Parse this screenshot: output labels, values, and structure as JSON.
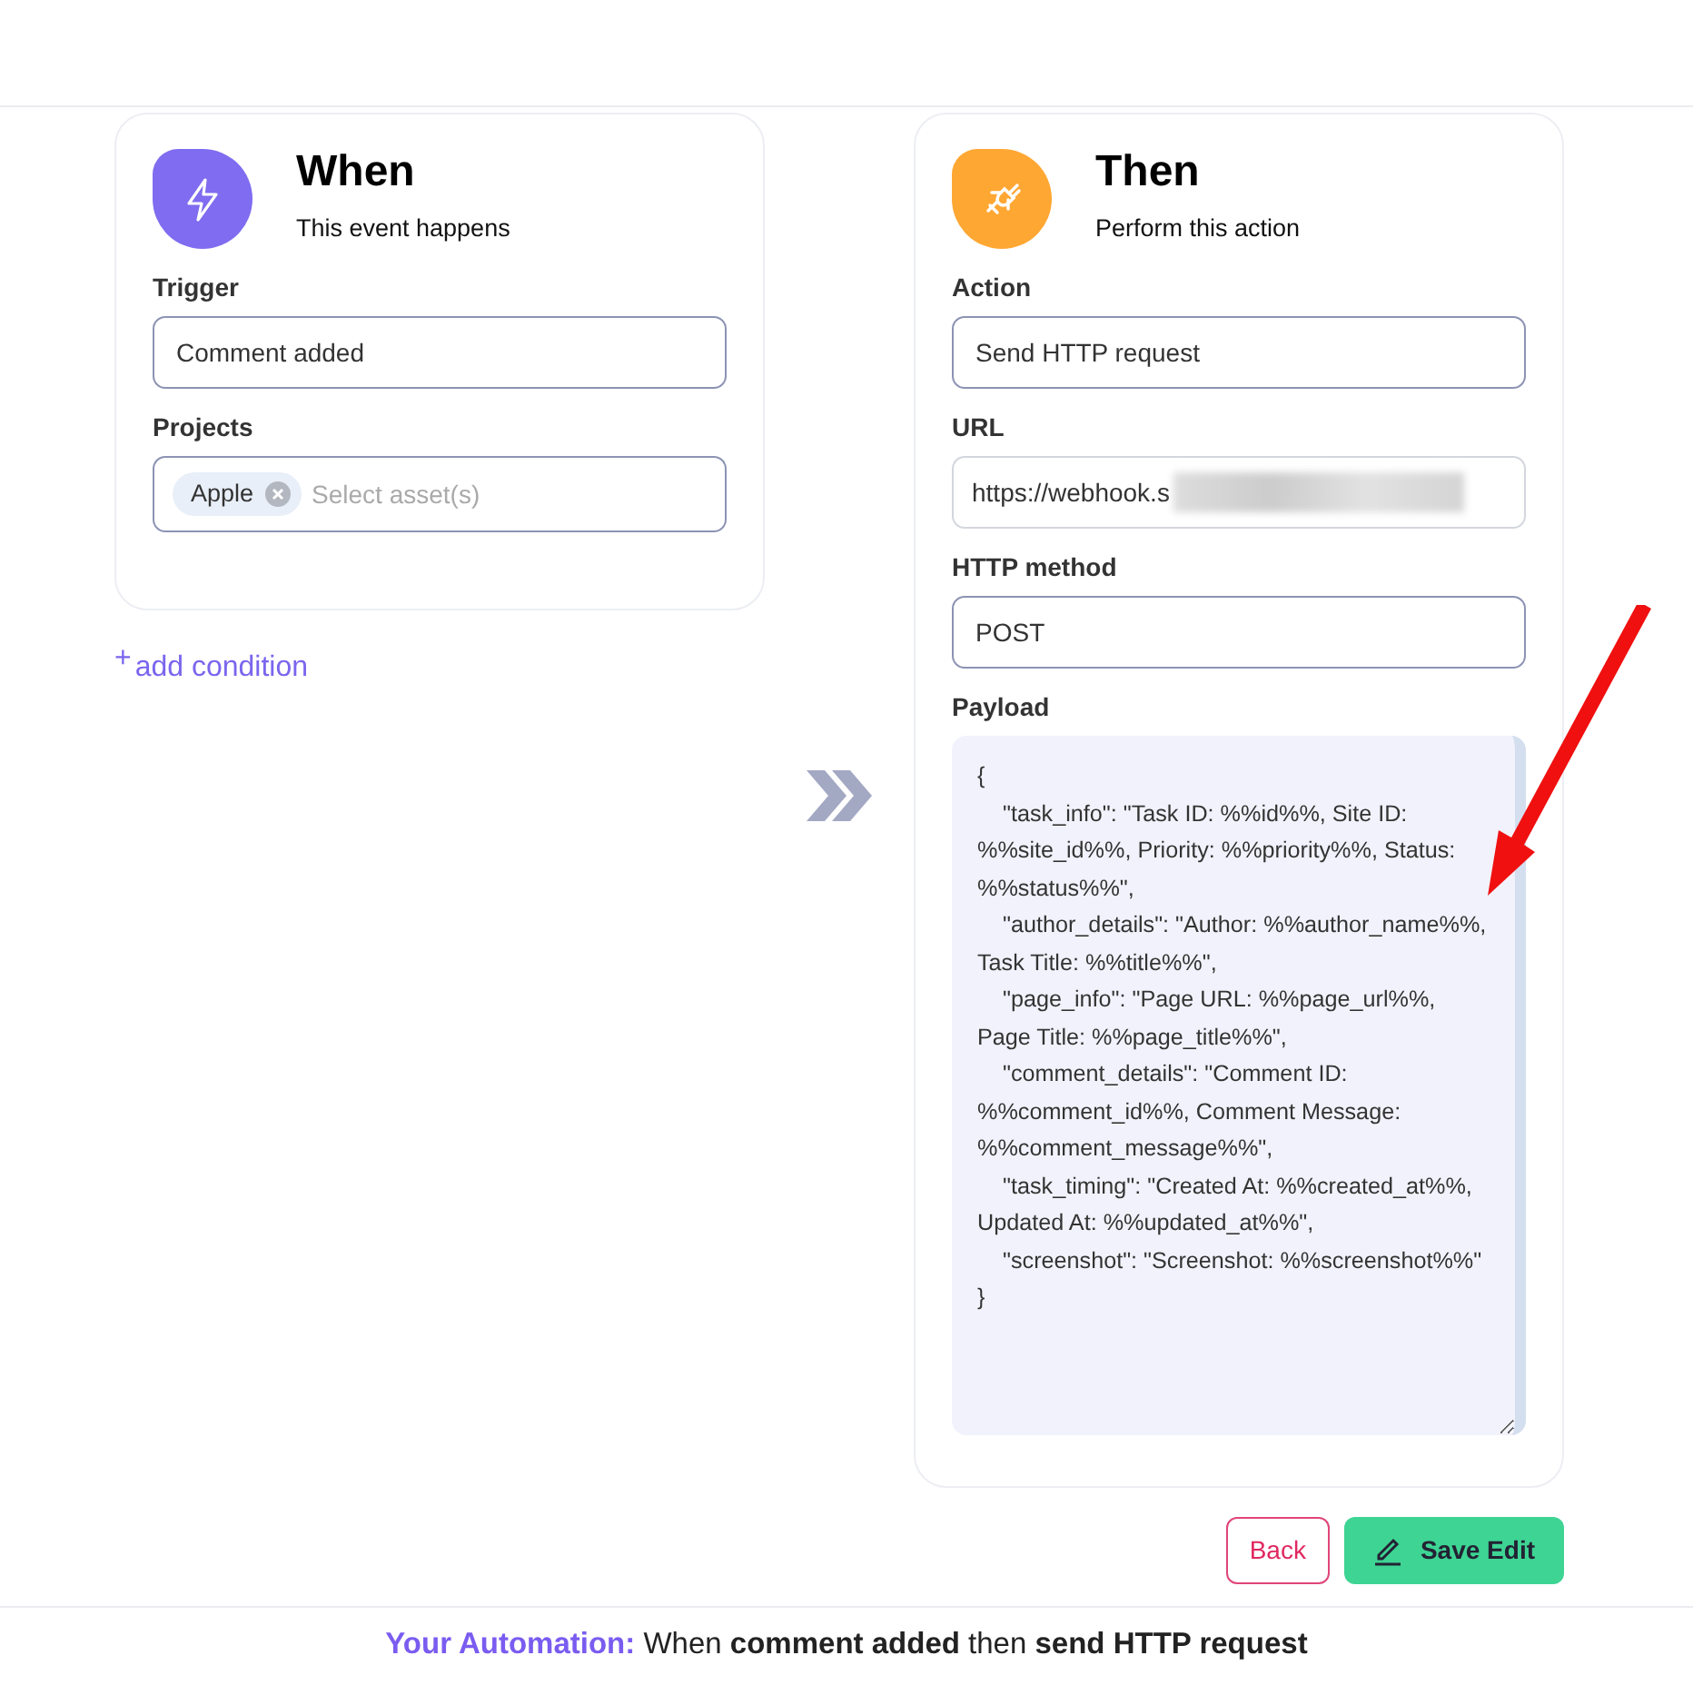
{
  "when": {
    "title": "When",
    "subtitle": "This event happens",
    "trigger": {
      "label": "Trigger",
      "value": "Comment added"
    },
    "projects": {
      "label": "Projects",
      "tags": [
        "Apple"
      ],
      "placeholder": "Select asset(s)"
    },
    "add_condition": {
      "icon": "+",
      "label": "add condition"
    }
  },
  "then": {
    "title": "Then",
    "subtitle": "Perform this action",
    "action": {
      "label": "Action",
      "value": "Send HTTP request"
    },
    "url": {
      "label": "URL",
      "value": "https://webhook.s"
    },
    "method": {
      "label": "HTTP method",
      "value": "POST"
    },
    "payload": {
      "label": "Payload",
      "value": "{\n    \"task_info\": \"Task ID: %%id%%, Site ID: %%site_id%%, Priority: %%priority%%, Status: %%status%%\",\n    \"author_details\": \"Author: %%author_name%%, Task Title: %%title%%\",\n    \"page_info\": \"Page URL: %%page_url%%, Page Title: %%page_title%%\",\n    \"comment_details\": \"Comment ID: %%comment_id%%, Comment Message: %%comment_message%%\",\n    \"task_timing\": \"Created At: %%created_at%%, Updated At: %%updated_at%%\",\n    \"screenshot\": \"Screenshot: %%screenshot%%\"\n}"
    }
  },
  "buttons": [
    {
      "kind": "back",
      "label": "Back"
    },
    {
      "kind": "save",
      "label": "Save Edit"
    }
  ],
  "summary": {
    "label": "Your Automation:",
    "text": "When **comment added** then **send HTTP request**"
  }
}
